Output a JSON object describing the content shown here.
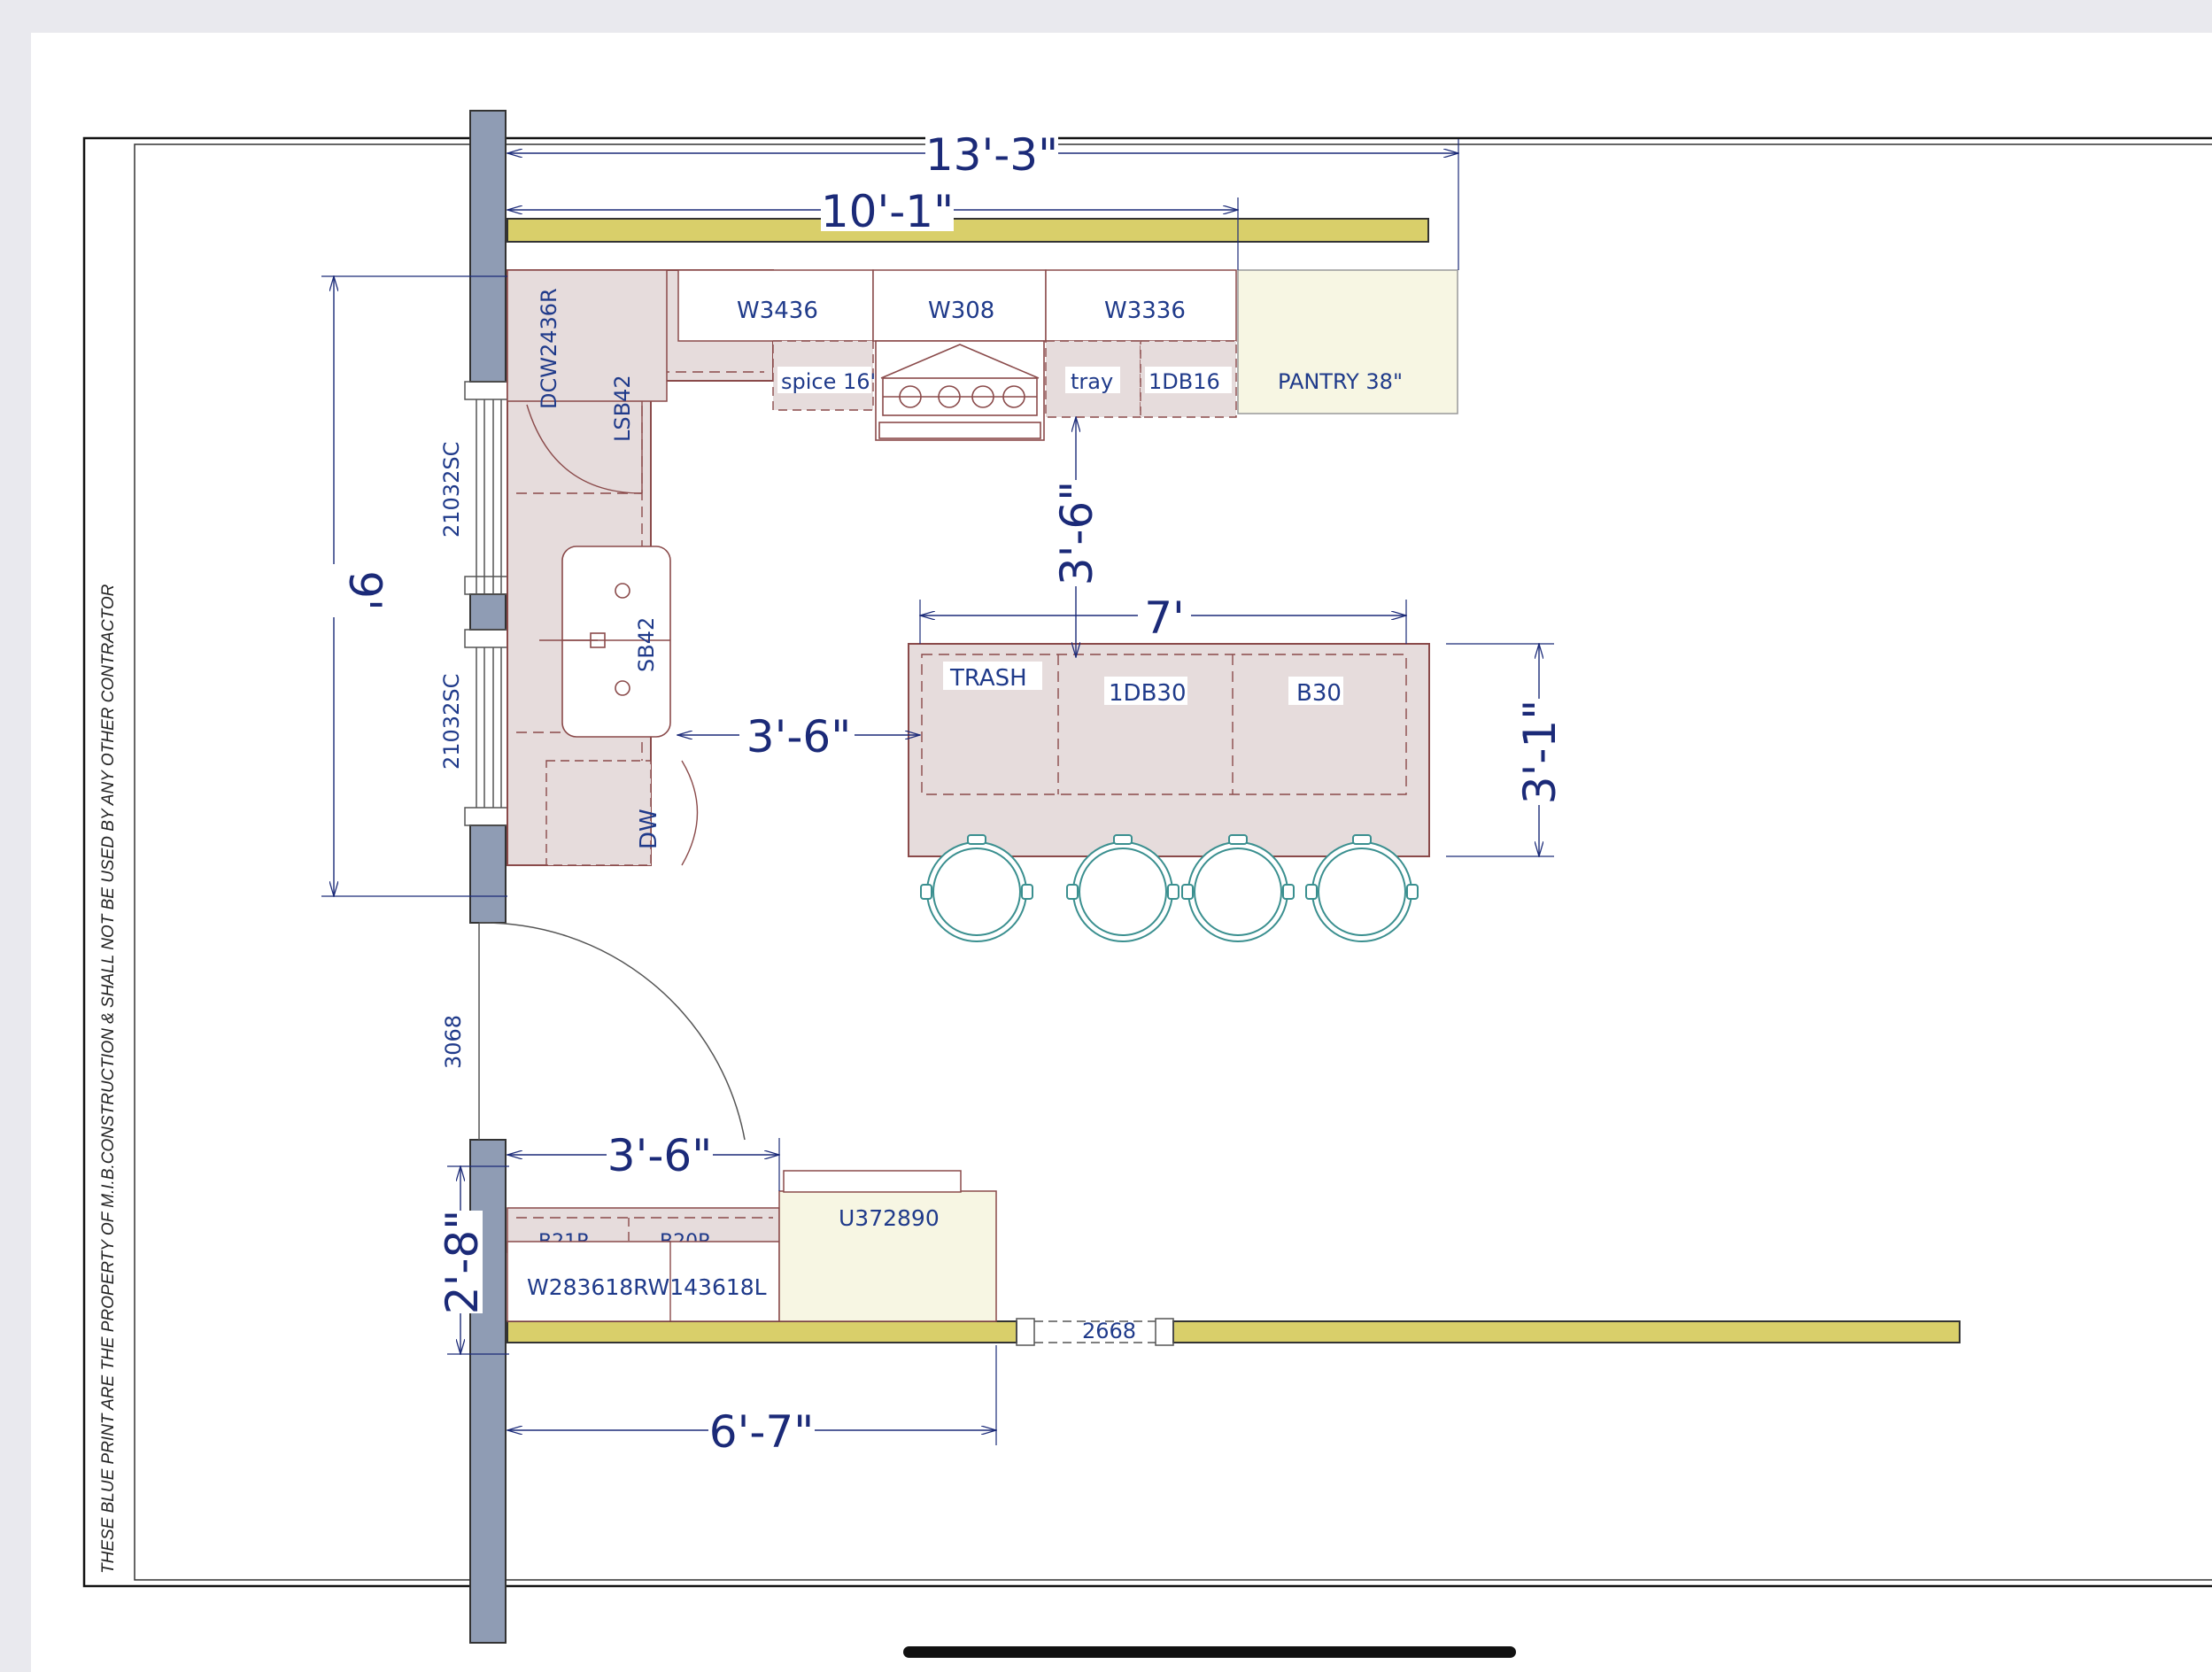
{
  "notice": "THESE BLUE PRINT ARE THE PROPERTY OF M.I.B.CONSTRUCTION & SHALL NOT BE USED BY ANY OTHER CONTRACTOR",
  "dimensions": {
    "overall_width": "13'-3\"",
    "upper_run": "10'-1\"",
    "left_wall": "9'",
    "aisle_vertical": "3'-6\"",
    "aisle_horizontal": "3'-6\"",
    "island_length": "7'",
    "island_depth": "3'-1\"",
    "door_clearance": "3'-6\"",
    "lower_depth": "2'-8\"",
    "lower_run": "6'-7\""
  },
  "windows": {
    "upper": "21032SC",
    "lower": "21032SC"
  },
  "doors": {
    "side": "3068",
    "bottom": "2668"
  },
  "cabinets": {
    "dcw": "DCW2436R",
    "lsb": "LSB42",
    "w3436": "W3436",
    "w308": "W308",
    "w3336": "W3336",
    "spice": "spice 16\"",
    "tray": "tray",
    "db16": "1DB16",
    "pantry": "PANTRY 38\"",
    "sb42": "SB42",
    "dw": "DW",
    "trash": "TRASH",
    "db30": "1DB30",
    "b30": "B30",
    "b21r": "B21R",
    "b20r": "B20R",
    "wall_lower": "W283618RW143618L",
    "fridge": "U372890"
  },
  "colors": {
    "wall": "#8f9cb4",
    "header": "#d9cf6a",
    "cabinet": "#e6dcdc",
    "pantry": "#f7f6e3",
    "dimension": "#1b2a78",
    "stool": "#3a8f8f"
  }
}
